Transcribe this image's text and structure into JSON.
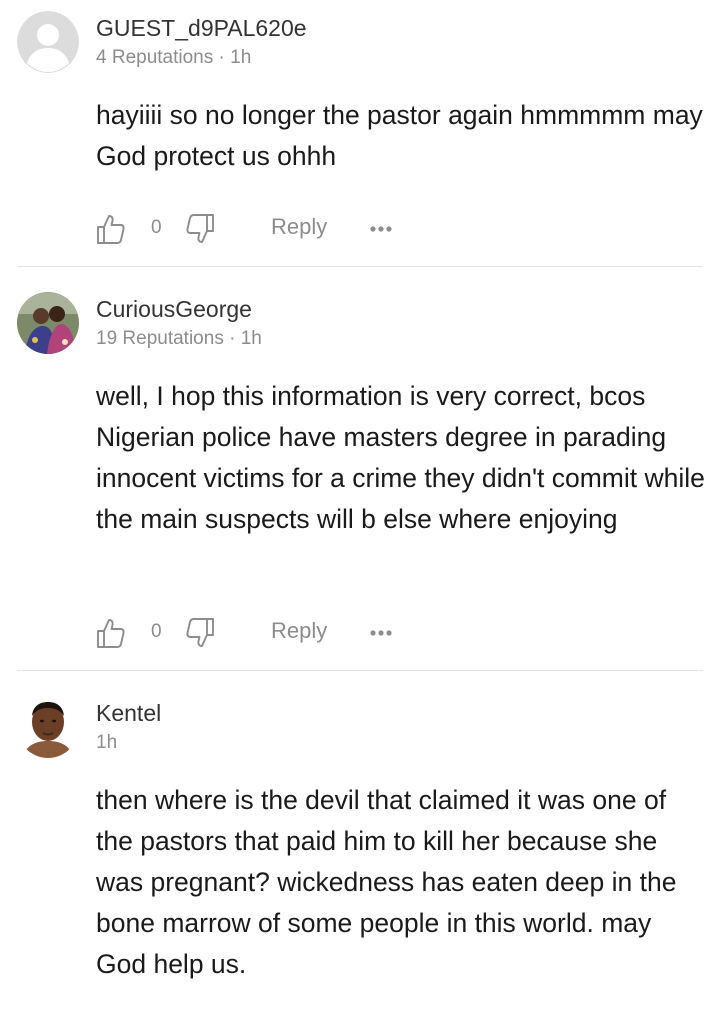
{
  "comments": [
    {
      "username": "GUEST_d9PAL620e",
      "meta": "4 Reputations · 1h",
      "text": "hayiiii so no longer the pastor again hmmmmm may God protect us ohhh",
      "likes": "0",
      "reply_label": "Reply",
      "avatar": "default-avatar-icon"
    },
    {
      "username": "CuriousGeorge",
      "meta": "19 Reputations · 1h",
      "text": "well, I hop this information is very correct, bcos Nigerian police have masters degree in parading innocent victims for a crime they didn't commit while the main suspects will b else where enjoying",
      "likes": "0",
      "reply_label": "Reply",
      "avatar": "user-photo-couple"
    },
    {
      "username": "Kentel",
      "meta": "1h",
      "text": "then where is the devil that claimed it was one of the pastors that paid him to kill her because she was pregnant? wickedness has eaten deep in the bone marrow of some people in this world. may God help us.",
      "avatar": "user-photo-man"
    }
  ],
  "colors": {
    "text": "#1a1a1a",
    "secondary": "#8c8c8c",
    "icon": "#8c8c8c",
    "divider": "#e4e4e4",
    "avatar_default": "#dcdcdc"
  }
}
